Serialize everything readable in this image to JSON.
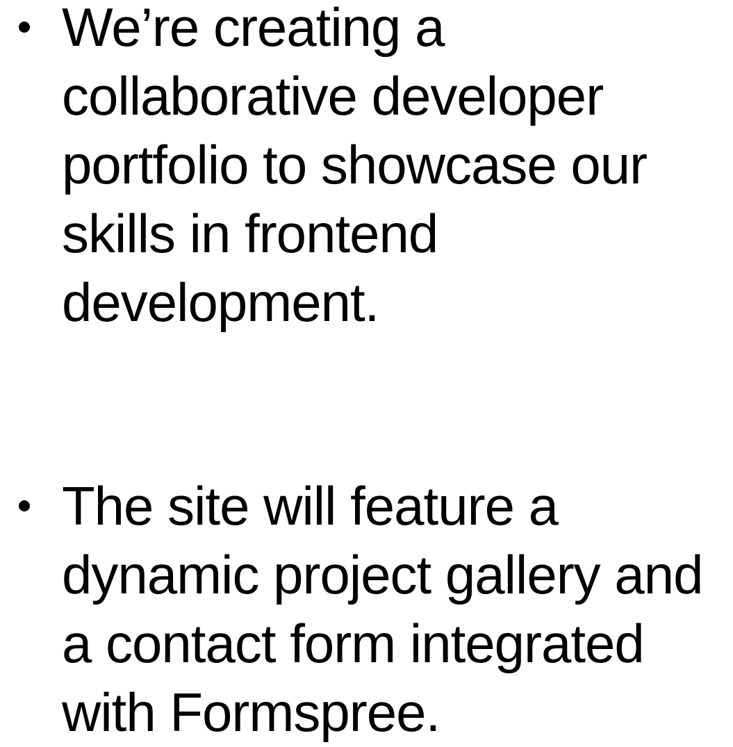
{
  "slide": {
    "bullets": [
      {
        "lines": [
          "We’re creating a",
          "collaborative developer",
          "portfolio to showcase our",
          "skills in frontend",
          "development."
        ]
      },
      {
        "lines": [
          "The site will feature a",
          "dynamic project gallery and",
          "a contact form integrated",
          "with Formspree."
        ]
      }
    ]
  }
}
